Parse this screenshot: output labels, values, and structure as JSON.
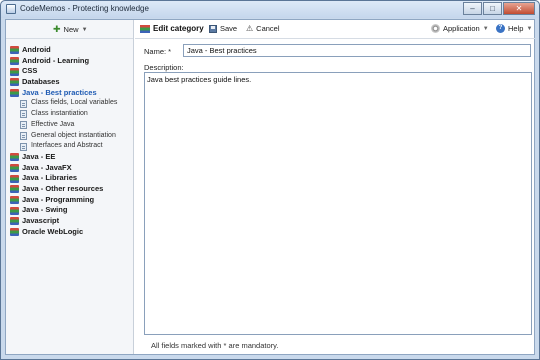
{
  "window": {
    "title": "CodeMemos - Protecting knowledge",
    "controls": [
      "–",
      "□",
      "✕"
    ]
  },
  "sidebar": {
    "new_label": "New",
    "tree": [
      {
        "label": "Android",
        "kind": "category",
        "selected": false
      },
      {
        "label": "Android - Learning",
        "kind": "category",
        "selected": false
      },
      {
        "label": "CSS",
        "kind": "category",
        "selected": false
      },
      {
        "label": "Databases",
        "kind": "category",
        "selected": false
      },
      {
        "label": "Java - Best practices",
        "kind": "category",
        "selected": true
      },
      {
        "label": "Class fields, Local variables",
        "kind": "memo",
        "selected": false
      },
      {
        "label": "Class instantiation",
        "kind": "memo",
        "selected": false
      },
      {
        "label": "Effective Java",
        "kind": "memo",
        "selected": false
      },
      {
        "label": "General object instantiation",
        "kind": "memo",
        "selected": false
      },
      {
        "label": "Interfaces and Abstract",
        "kind": "memo",
        "selected": false
      },
      {
        "label": "Java - EE",
        "kind": "category",
        "selected": false
      },
      {
        "label": "Java - JavaFX",
        "kind": "category",
        "selected": false
      },
      {
        "label": "Java - Libraries",
        "kind": "category",
        "selected": false
      },
      {
        "label": "Java - Other resources",
        "kind": "category",
        "selected": false
      },
      {
        "label": "Java - Programming",
        "kind": "category",
        "selected": false
      },
      {
        "label": "Java - Swing",
        "kind": "category",
        "selected": false
      },
      {
        "label": "Javascript",
        "kind": "category",
        "selected": false
      },
      {
        "label": "Oracle WebLogic",
        "kind": "category",
        "selected": false
      }
    ]
  },
  "toolbar": {
    "edit_category": "Edit category",
    "save": "Save",
    "cancel": "Cancel",
    "application": "Application",
    "help": "Help"
  },
  "form": {
    "name_label": "Name: *",
    "name_value": "Java - Best practices",
    "description_label": "Description:",
    "description_value": "Java best practices guide lines.",
    "footer_note": "All fields marked with * are mandatory."
  },
  "colors": {
    "selected_text": "#1f5bb3",
    "frame": "#c9d9ec",
    "close_button": "#c14b32"
  }
}
